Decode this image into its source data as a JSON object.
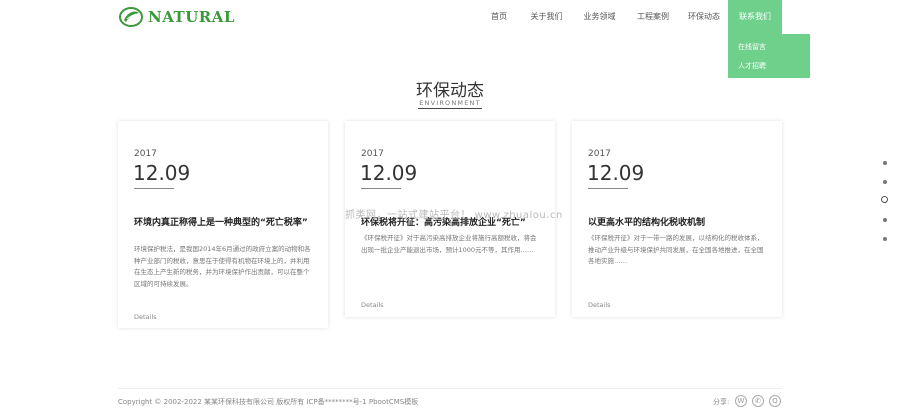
{
  "header": {
    "logo_text": "NATURAL",
    "brand_color": "#3a9a3a",
    "nav": [
      {
        "label": "首页"
      },
      {
        "label": "关于我们"
      },
      {
        "label": "业务领域"
      },
      {
        "label": "工程案例"
      },
      {
        "label": "环保动态"
      },
      {
        "label": "联系我们"
      }
    ],
    "active_nav_color": "#6fd08c",
    "dropdown": [
      "在线留言",
      "人才招聘"
    ]
  },
  "section": {
    "title": "环保动态",
    "subtitle": "ENVIRONMENT"
  },
  "news": [
    {
      "year": "2017",
      "date": "12.09",
      "title": "环境内真正称得上是一种典型的“死亡税率”",
      "excerpt": "环境保护税法，是我国2014年6月通过的政府立案的动物和各种产业部门的税收，意思在于使得有机物在环境上的，并利用在生态上产生新的税务，并为环境保护作出贡献，可以在整个区域的可持续发展。",
      "link": "Details"
    },
    {
      "year": "2017",
      "date": "12.09",
      "title": "环保税将开征：高污染高排放企业“死亡”",
      "excerpt": "《环保税开征》对于高污染高排放企业将施行高额税收，将会出现一批企业产能退出市场，预计1000元不等，其作用……",
      "link": "Details"
    },
    {
      "year": "2017",
      "date": "12.09",
      "title": "以更高水平的结构化税收机制",
      "excerpt": "《环保税开征》对于一带一路的发展，以结构化的税收体系，推动产业升级与环境保护共同发展，在全国各地推进，在全国各地实施……",
      "link": "Details"
    }
  ],
  "watermark": "抓类网，一站式建站平台！ www.zhualou.cn",
  "footer": {
    "copyright": "Copyright © 2002-2022 某某环保科技有限公司 版权所有 ICP备********号-1 PbootCMS模板",
    "share_label": "分享:",
    "share_icons": [
      "weibo-icon",
      "wechat-icon",
      "qq-icon"
    ]
  }
}
